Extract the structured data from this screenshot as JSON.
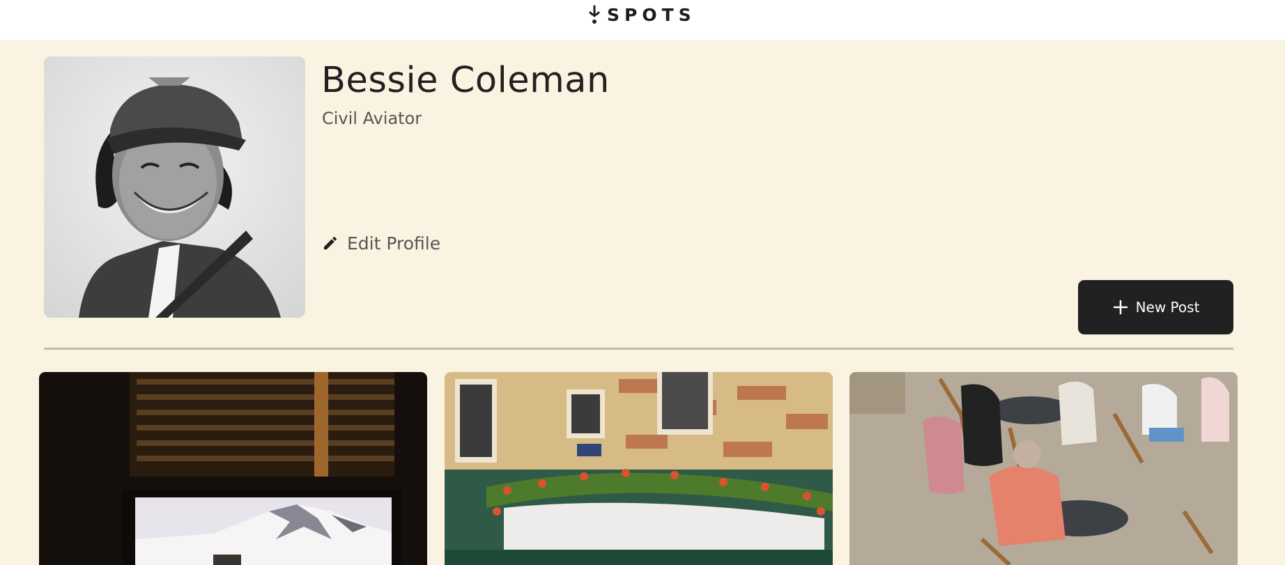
{
  "header": {
    "logo_text": "SPOTS",
    "logo_icon": "spots-pin-icon"
  },
  "profile": {
    "name": "Bessie Coleman",
    "description": "Civil Aviator",
    "avatar_alt": "Bessie Coleman",
    "edit_label": "Edit Profile",
    "edit_icon": "pencil-icon"
  },
  "actions": {
    "new_post_label": "New Post",
    "new_post_icon": "plus-icon"
  },
  "cards": [
    {
      "image_alt": "Snowy mountain through a window"
    },
    {
      "image_alt": "Parisian restaurant with flower garland"
    },
    {
      "image_alt": "Outdoor cafe terrace"
    }
  ],
  "colors": {
    "background": "#fbf3e2",
    "text": "#212121",
    "button": "#212121",
    "divider": "#c2bbac"
  }
}
